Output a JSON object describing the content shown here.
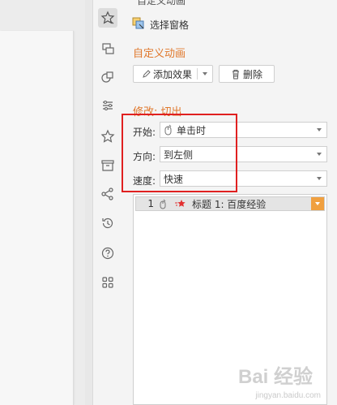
{
  "pane_title": "自定义动画",
  "selection_pane": {
    "label": "选择窗格"
  },
  "custom_anim": {
    "title": "自定义动画",
    "add_effect_label": "添加效果",
    "delete_label": "删除"
  },
  "modify": {
    "title": "修改: 切出",
    "start": {
      "label": "开始:",
      "value": "单击时"
    },
    "direction": {
      "label": "方向:",
      "value": "到左侧"
    },
    "speed": {
      "label": "速度:",
      "value": "快速"
    }
  },
  "anim_list": [
    {
      "index": "1",
      "text": "标题 1: 百度经验"
    }
  ],
  "watermark": {
    "logo": "Bai 经验",
    "url": "jingyan.baidu.com"
  },
  "colors": {
    "accent": "#e0782c",
    "highlight": "#e02020",
    "list_arrow": "#f0a040"
  }
}
